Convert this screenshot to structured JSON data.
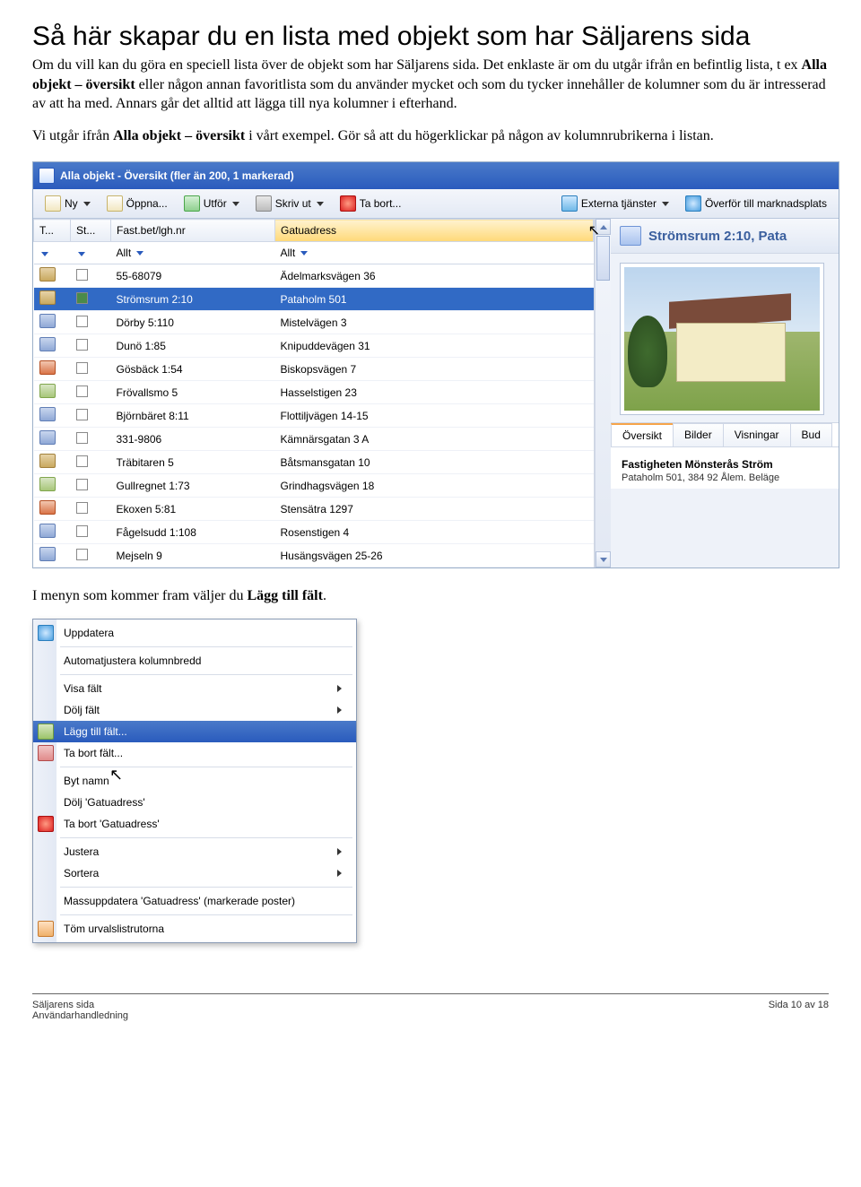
{
  "doc": {
    "heading": "Så här skapar du en lista med objekt som har Säljarens sida",
    "p1a": "Om du vill kan du göra en speciell lista över de objekt som har Säljarens sida. Det enklaste är om du utgår ifrån en befintlig lista, t ex ",
    "p1b": "Alla objekt – översikt",
    "p1c": " eller någon annan favoritlista som du använder mycket och som du tycker innehåller de kolumner som du är intresserad av att ha med. Annars går det alltid att lägga till nya kolumner i efterhand.",
    "p2a": "Vi utgår ifrån ",
    "p2b": "Alla objekt – översikt",
    "p2c": " i vårt exempel. Gör så att du högerklickar på någon av kolumnrubrikerna i listan.",
    "p3a": "I menyn som kommer fram väljer du ",
    "p3b": "Lägg till fält",
    "p3c": "."
  },
  "app": {
    "title": "Alla objekt - Översikt (fler än 200, 1 markerad)",
    "toolbar": {
      "ny": "Ny",
      "open": "Öppna...",
      "utfor": "Utför",
      "print": "Skriv ut",
      "del": "Ta bort...",
      "ext": "Externa tjänster",
      "transfer": "Överför till marknadsplats"
    },
    "cols": {
      "c1": "T...",
      "c2": "St...",
      "c3": "Fast.bet/lgh.nr",
      "c4": "Gatuadress"
    },
    "filter": {
      "f3": "Allt",
      "f4": "Allt"
    },
    "rows": [
      {
        "t": "house",
        "chk": false,
        "id": "55-68079",
        "addr": "Ädelmarksvägen 36"
      },
      {
        "t": "house",
        "chk": true,
        "sel": true,
        "id": "Strömsrum 2:10",
        "addr": "Pataholm 501"
      },
      {
        "t": "build",
        "chk": false,
        "id": "Dörby 5:110",
        "addr": "Mistelvägen 3"
      },
      {
        "t": "build",
        "chk": false,
        "id": "Dunö 1:85",
        "addr": "Knipuddevägen 31"
      },
      {
        "t": "tractor",
        "chk": false,
        "id": "Gösbäck 1:54",
        "addr": "Biskopsvägen 7"
      },
      {
        "t": "flat",
        "chk": false,
        "id": "Frövallsmo 5",
        "addr": "Hasselstigen 23"
      },
      {
        "t": "build",
        "chk": false,
        "id": "Björnbäret 8:11",
        "addr": "Flottiljvägen 14-15"
      },
      {
        "t": "build",
        "chk": false,
        "id": "331-9806",
        "addr": "Kämnärsgatan 3 A"
      },
      {
        "t": "house",
        "chk": false,
        "id": "Träbitaren 5",
        "addr": "Båtsmansgatan 10"
      },
      {
        "t": "flat",
        "chk": false,
        "id": "Gullregnet 1:73",
        "addr": "Grindhagsvägen 18"
      },
      {
        "t": "tractor",
        "chk": false,
        "id": "Ekoxen 5:81",
        "addr": "Stensätra 1297"
      },
      {
        "t": "build",
        "chk": false,
        "id": "Fågelsudd 1:108",
        "addr": "Rosenstigen 4"
      },
      {
        "t": "build",
        "chk": false,
        "id": "Mejseln 9",
        "addr": "Husängsvägen 25-26"
      }
    ],
    "side": {
      "title": "Strömsrum 2:10, Pata",
      "tabs": {
        "t1": "Översikt",
        "t2": "Bilder",
        "t3": "Visningar",
        "t4": "Bud"
      },
      "bold": "Fastigheten Mönsterås Ström",
      "sub": "Pataholm 501, 384 92 Ålem. Beläge"
    }
  },
  "menu": {
    "refresh": "Uppdatera",
    "autow": "Automatjustera kolumnbredd",
    "show": "Visa fält",
    "hide": "Dölj fält",
    "add": "Lägg till fält...",
    "remove": "Ta bort fält...",
    "rename": "Byt namn",
    "hideaddr": "Dölj 'Gatuadress'",
    "deladdr": "Ta bort 'Gatuadress'",
    "adjust": "Justera",
    "sort": "Sortera",
    "massupd": "Massuppdatera 'Gatuadress' (markerade poster)",
    "clear": "Töm urvalslistrutorna"
  },
  "footer": {
    "left1": "Säljarens sida",
    "left2": "Användarhandledning",
    "right": "Sida 10 av 18"
  }
}
